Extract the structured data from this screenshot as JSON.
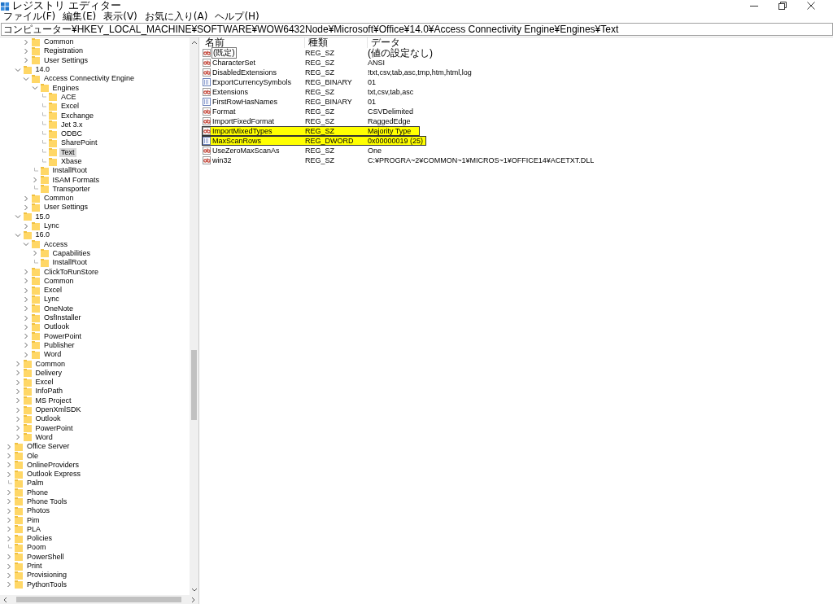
{
  "window": {
    "title": "レジストリ エディター"
  },
  "menu": [
    "ファイル(F)",
    "編集(E)",
    "表示(V)",
    "お気に入り(A)",
    "ヘルプ(H)"
  ],
  "address": "コンピューター¥HKEY_LOCAL_MACHINE¥SOFTWARE¥WOW6432Node¥Microsoft¥Office¥14.0¥Access Connectivity Engine¥Engines¥Text",
  "tree": [
    {
      "children": [
        {
          "children": [
            {
              "label": "Common",
              "expanded": false,
              "selected": false
            },
            {
              "label": "Registration",
              "expanded": false,
              "selected": false
            },
            {
              "label": "User Settings",
              "expanded": false,
              "selected": false
            }
          ]
        },
        {
          "label": "14.0",
          "expanded": true,
          "selected": false,
          "children": [
            {
              "label": "Access Connectivity Engine",
              "expanded": true,
              "selected": false,
              "children": [
                {
                  "label": "Engines",
                  "expanded": true,
                  "selected": false,
                  "children": [
                    {
                      "label": "ACE",
                      "selected": false
                    },
                    {
                      "label": "Excel",
                      "selected": false
                    },
                    {
                      "label": "Exchange",
                      "selected": false
                    },
                    {
                      "label": "Jet 3.x",
                      "selected": false
                    },
                    {
                      "label": "ODBC",
                      "selected": false
                    },
                    {
                      "label": "SharePoint",
                      "selected": false
                    },
                    {
                      "label": "Text",
                      "selected": true
                    },
                    {
                      "label": "Xbase",
                      "selected": false
                    }
                  ]
                },
                {
                  "label": "InstallRoot",
                  "selected": false
                },
                {
                  "label": "ISAM Formats",
                  "expanded": false,
                  "selected": false
                },
                {
                  "label": "Transporter",
                  "selected": false
                }
              ]
            },
            {
              "label": "Common",
              "expanded": false,
              "selected": false
            },
            {
              "label": "User Settings",
              "expanded": false,
              "selected": false
            }
          ]
        },
        {
          "label": "15.0",
          "expanded": true,
          "selected": false,
          "children": [
            {
              "label": "Lync",
              "expanded": false,
              "selected": false
            }
          ]
        },
        {
          "label": "16.0",
          "expanded": true,
          "selected": false,
          "children": [
            {
              "label": "Access",
              "expanded": true,
              "selected": false,
              "children": [
                {
                  "label": "Capabilities",
                  "expanded": false,
                  "selected": false
                },
                {
                  "label": "InstallRoot",
                  "selected": false
                }
              ]
            },
            {
              "label": "ClickToRunStore",
              "expanded": false,
              "selected": false
            },
            {
              "label": "Common",
              "expanded": false,
              "selected": false
            },
            {
              "label": "Excel",
              "expanded": false,
              "selected": false
            },
            {
              "label": "Lync",
              "expanded": false,
              "selected": false
            },
            {
              "label": "OneNote",
              "expanded": false,
              "selected": false
            },
            {
              "label": "OsfInstaller",
              "expanded": false,
              "selected": false
            },
            {
              "label": "Outlook",
              "expanded": false,
              "selected": false
            },
            {
              "label": "PowerPoint",
              "expanded": false,
              "selected": false
            },
            {
              "label": "Publisher",
              "expanded": false,
              "selected": false
            },
            {
              "label": "Word",
              "expanded": false,
              "selected": false
            }
          ]
        },
        {
          "label": "Common",
          "expanded": false,
          "selected": false
        },
        {
          "label": "Delivery",
          "expanded": false,
          "selected": false
        },
        {
          "label": "Excel",
          "expanded": false,
          "selected": false
        },
        {
          "label": "InfoPath",
          "expanded": false,
          "selected": false
        },
        {
          "label": "MS Project",
          "expanded": false,
          "selected": false
        },
        {
          "label": "OpenXmlSDK",
          "expanded": false,
          "selected": false
        },
        {
          "label": "Outlook",
          "expanded": false,
          "selected": false
        },
        {
          "label": "PowerPoint",
          "expanded": false,
          "selected": false
        },
        {
          "label": "Word",
          "expanded": false,
          "selected": false
        }
      ]
    },
    {
      "label": "Office Server",
      "expanded": false,
      "selected": false
    },
    {
      "label": "Ole",
      "expanded": false,
      "selected": false
    },
    {
      "label": "OnlineProviders",
      "expanded": false,
      "selected": false
    },
    {
      "label": "Outlook Express",
      "expanded": false,
      "selected": false
    },
    {
      "label": "Palm",
      "selected": false
    },
    {
      "label": "Phone",
      "expanded": false,
      "selected": false
    },
    {
      "label": "Phone Tools",
      "expanded": false,
      "selected": false
    },
    {
      "label": "Photos",
      "expanded": false,
      "selected": false
    },
    {
      "label": "Pim",
      "expanded": false,
      "selected": false
    },
    {
      "label": "PLA",
      "expanded": false,
      "selected": false
    },
    {
      "label": "Policies",
      "expanded": false,
      "selected": false
    },
    {
      "label": "Poom",
      "selected": false
    },
    {
      "label": "PowerShell",
      "expanded": false,
      "selected": false
    },
    {
      "label": "Print",
      "expanded": false,
      "selected": false
    },
    {
      "label": "Provisioning",
      "expanded": false,
      "selected": false
    },
    {
      "label": "PythonTools",
      "expanded": false,
      "selected": false
    }
  ],
  "table": {
    "columns": [
      "名前",
      "種類",
      "データ"
    ],
    "rows": [
      {
        "kind": "string",
        "name": "(既定)",
        "type": "REG_SZ",
        "data": "(値の設定なし)",
        "focused": true,
        "highlighted": false
      },
      {
        "kind": "string",
        "name": "CharacterSet",
        "type": "REG_SZ",
        "data": "ANSI",
        "focused": false,
        "highlighted": false
      },
      {
        "kind": "string",
        "name": "DisabledExtensions",
        "type": "REG_SZ",
        "data": "!txt,csv,tab,asc,tmp,htm,html,log",
        "focused": false,
        "highlighted": false
      },
      {
        "kind": "binary",
        "name": "ExportCurrencySymbols",
        "type": "REG_BINARY",
        "data": "01",
        "focused": false,
        "highlighted": false
      },
      {
        "kind": "string",
        "name": "Extensions",
        "type": "REG_SZ",
        "data": "txt,csv,tab,asc",
        "focused": false,
        "highlighted": false
      },
      {
        "kind": "binary",
        "name": "FirstRowHasNames",
        "type": "REG_BINARY",
        "data": "01",
        "focused": false,
        "highlighted": false
      },
      {
        "kind": "string",
        "name": "Format",
        "type": "REG_SZ",
        "data": "CSVDelimited",
        "focused": false,
        "highlighted": false
      },
      {
        "kind": "string",
        "name": "ImportFixedFormat",
        "type": "REG_SZ",
        "data": "RaggedEdge",
        "focused": false,
        "highlighted": false
      },
      {
        "kind": "string",
        "name": "ImportMixedTypes",
        "type": "REG_SZ",
        "data": "Majority Type",
        "focused": false,
        "highlighted": true
      },
      {
        "kind": "binary",
        "name": "MaxScanRows",
        "type": "REG_DWORD",
        "data": "0x00000019 (25)",
        "focused": false,
        "highlighted": true
      },
      {
        "kind": "string",
        "name": "UseZeroMaxScanAs",
        "type": "REG_SZ",
        "data": "One",
        "focused": false,
        "highlighted": false
      },
      {
        "kind": "string",
        "name": "win32",
        "type": "REG_SZ",
        "data": "C:¥PROGRA~2¥COMMON~1¥MICROS~1¥OFFICE14¥ACETXT.DLL",
        "focused": false,
        "highlighted": false
      }
    ]
  }
}
